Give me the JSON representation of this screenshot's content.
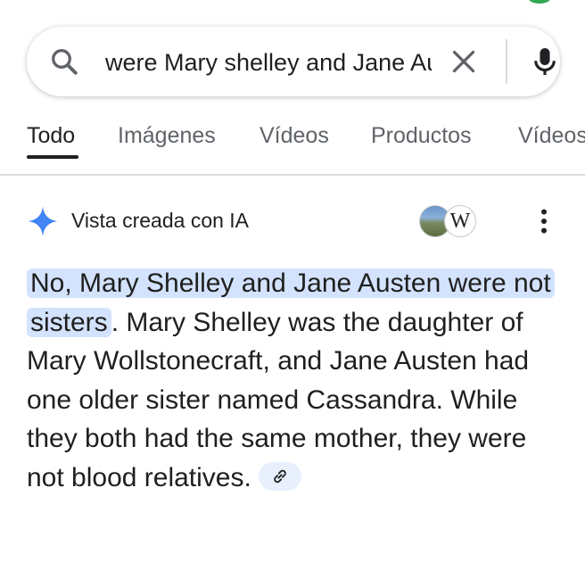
{
  "search": {
    "query": "were Mary shelley and Jane Austen sisters"
  },
  "tabs": [
    {
      "label": "Todo",
      "active": true
    },
    {
      "label": "Imágenes",
      "active": false
    },
    {
      "label": "Vídeos",
      "active": false
    },
    {
      "label": "Productos",
      "active": false
    },
    {
      "label": "Vídeos",
      "active": false
    }
  ],
  "ai_overview": {
    "title": "Vista creada con IA",
    "source_wiki_letter": "W",
    "answer_highlight": "No, Mary Shelley and Jane Austen were not sisters",
    "answer_rest": ". Mary Shelley was the daughter of Mary Wollstonecraft, and Jane Austen had one older sister named Cassandra. While they both had the same mother, they were not blood relatives."
  },
  "colors": {
    "highlight": "#d3e3fd",
    "spark_blue": "#4285f4",
    "chip_bg": "#e8f0fe",
    "divider": "#dadce0"
  },
  "icons": {
    "search": "search-icon",
    "clear": "close-icon",
    "mic": "mic-icon",
    "spark": "sparkle-icon",
    "more": "more-vert-icon",
    "link": "link-icon"
  }
}
